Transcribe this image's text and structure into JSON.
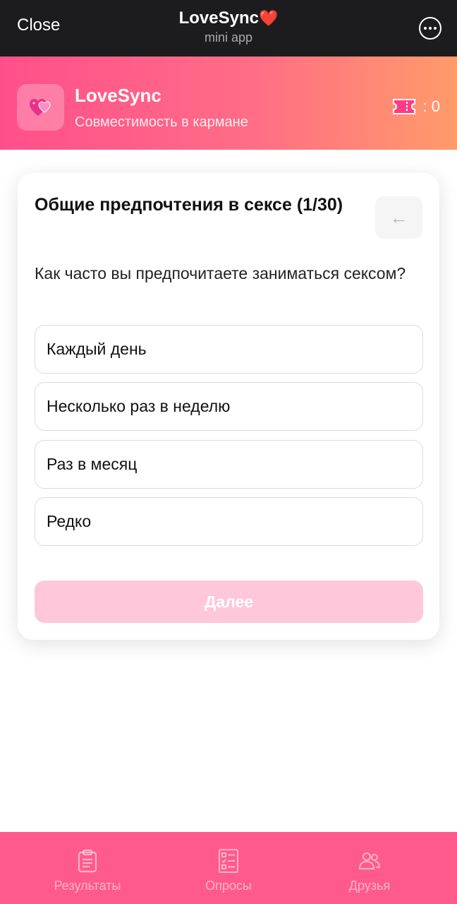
{
  "topbar": {
    "close_label": "Close",
    "title": "LoveSync",
    "title_emoji": "❤️",
    "subtitle": "mini app"
  },
  "header": {
    "app_name": "LoveSync",
    "tagline": "Совместимость в кармане",
    "tickets_count": ": 0"
  },
  "quiz": {
    "title": "Общие предпочтения в сексе (1/30)",
    "question": "Как часто вы предпочитаете заниматься сексом?",
    "options": [
      {
        "label": "Каждый день"
      },
      {
        "label": "Несколько раз в неделю"
      },
      {
        "label": "Раз в месяц"
      },
      {
        "label": "Редко"
      }
    ],
    "next_label": "Далее"
  },
  "nav": {
    "items": [
      {
        "label": "Результаты",
        "icon": "clipboard-icon"
      },
      {
        "label": "Опросы",
        "icon": "checklist-icon"
      },
      {
        "label": "Друзья",
        "icon": "users-icon"
      }
    ]
  },
  "colors": {
    "accent": "#ff5a8c",
    "gradient_start": "#ff4f8b",
    "gradient_end": "#ff9b6a",
    "button_disabled": "#ffc7da"
  }
}
